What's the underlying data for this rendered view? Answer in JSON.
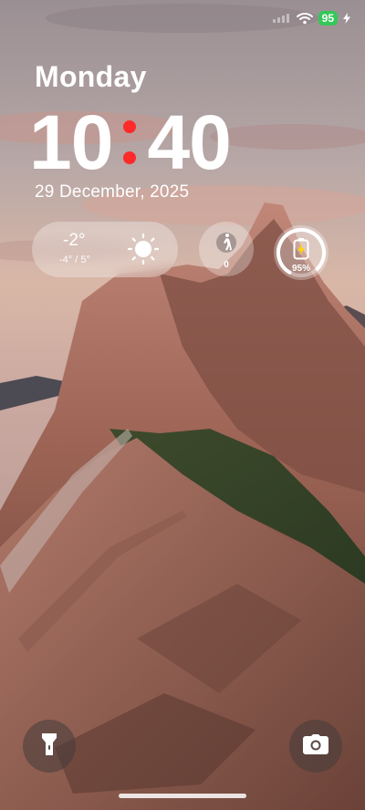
{
  "status_bar": {
    "battery_level": "95",
    "icons": [
      "signal-icon",
      "wifi-icon",
      "charging-icon"
    ],
    "battery_color": "#34c759"
  },
  "lockscreen": {
    "day": "Monday",
    "time_hours": "10",
    "time_minutes": "40",
    "colon_color": "#ff2a2a",
    "date": "29 December, 2025"
  },
  "widgets": {
    "weather": {
      "temperature": "-2°",
      "range": "-4° / 5°",
      "icon": "sun-icon"
    },
    "steps": {
      "count": "0",
      "icon": "walking-person-icon"
    },
    "battery": {
      "percent_label": "95%",
      "level": 0.95,
      "icon": "battery-icon"
    }
  },
  "shortcuts": {
    "left": "flashlight-icon",
    "right": "camera-icon"
  }
}
